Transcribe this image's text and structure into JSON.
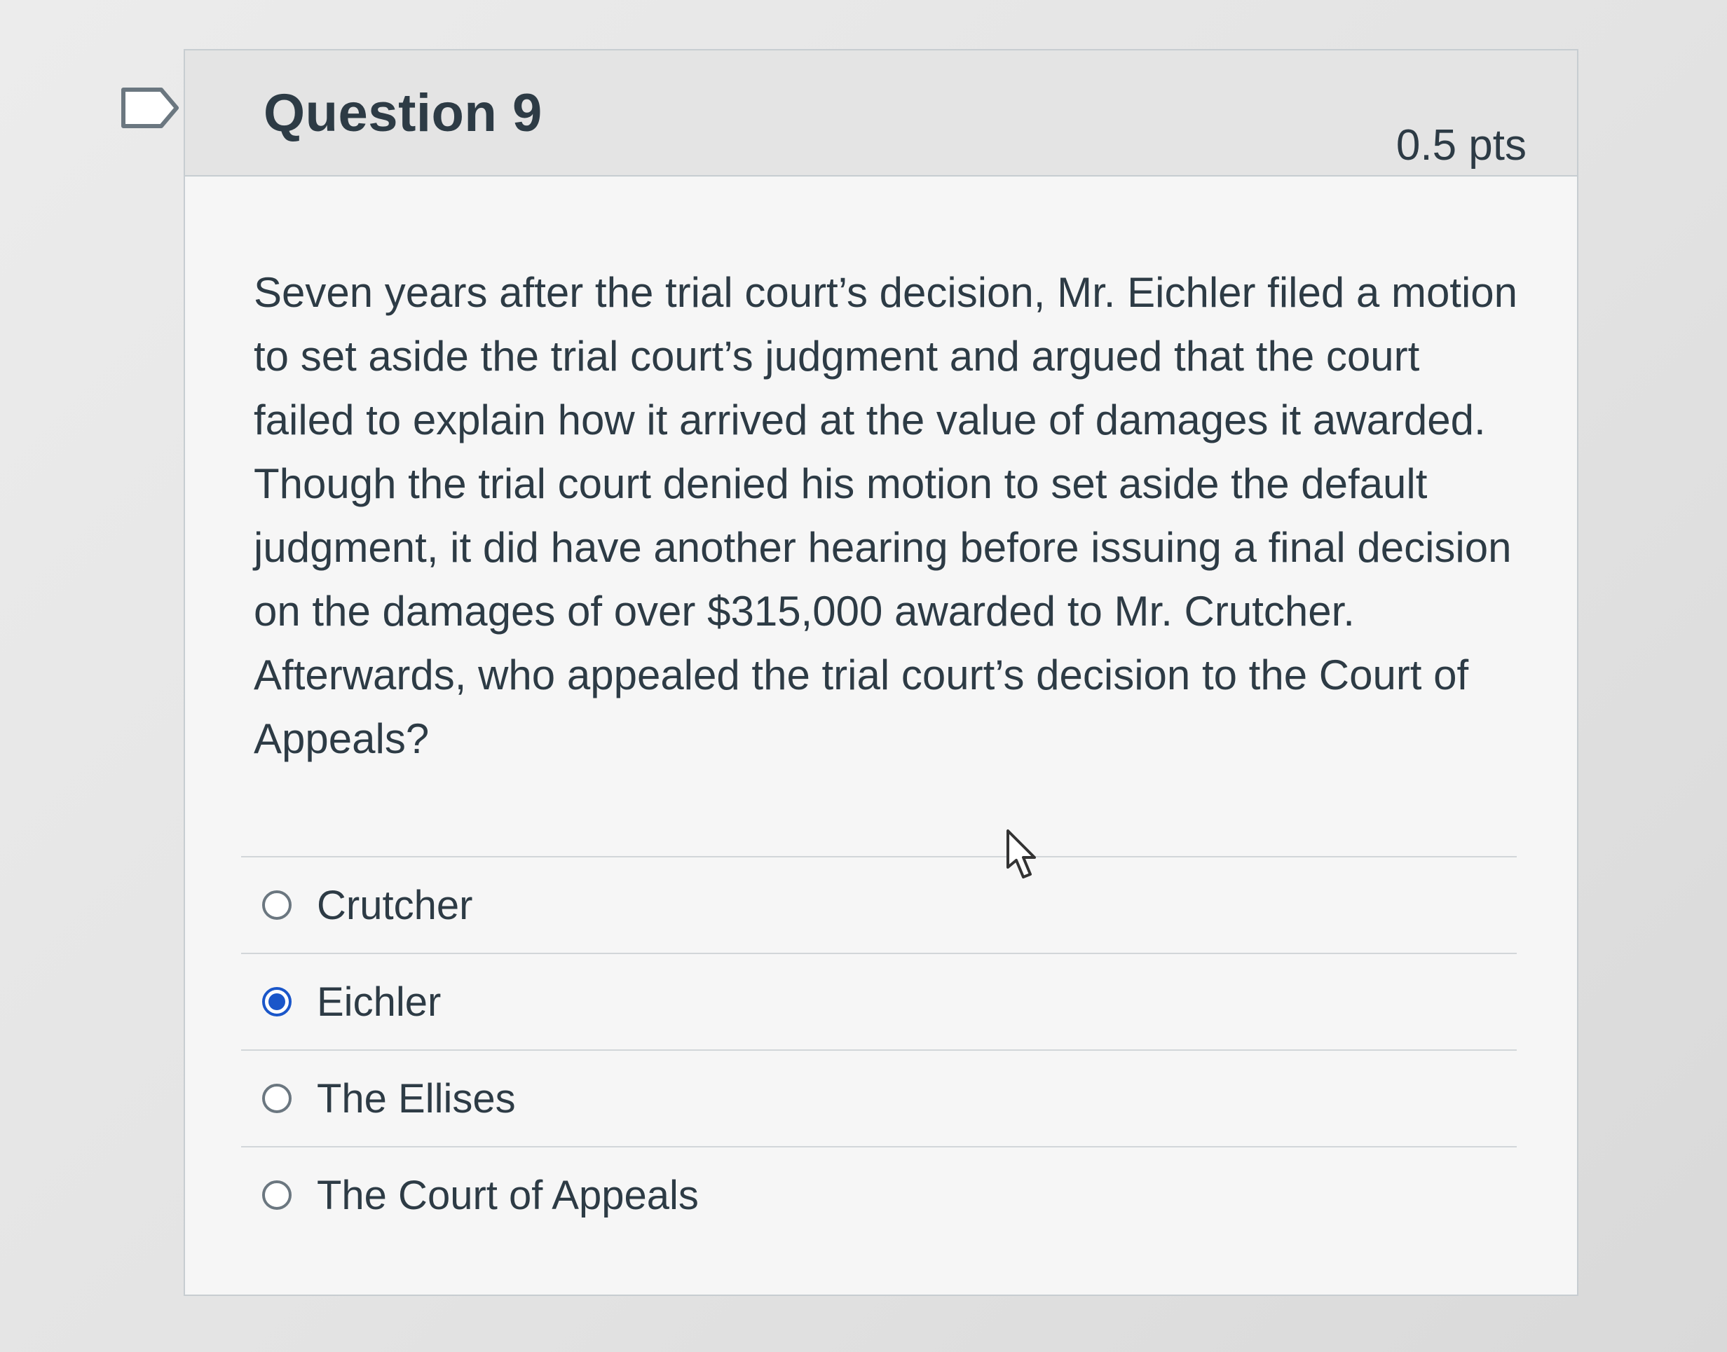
{
  "question": {
    "title": "Question 9",
    "points": "0.5 pts",
    "text": "Seven years after the trial court’s decision, Mr. Eichler filed a motion to set aside the trial court’s judgment and argued that the court failed to explain how it arrived at the value of damages it awarded. Though the trial court denied his motion to set aside the default judgment, it did have another hearing before issuing a final decision on the damages of over $315,000 awarded to Mr. Crutcher. Afterwards, who appealed the trial court’s decision to the Court of Appeals?",
    "answers": [
      {
        "label": "Crutcher",
        "selected": false
      },
      {
        "label": "Eichler",
        "selected": true
      },
      {
        "label": "The Ellises",
        "selected": false
      },
      {
        "label": "The Court of Appeals",
        "selected": false
      }
    ]
  },
  "icons": {
    "flag": "flag-question-icon",
    "cursor": "mouse-pointer-icon"
  },
  "colors": {
    "selected_radio": "#1a56c9",
    "header_bg": "#e4e4e4",
    "text": "#2d3b45"
  }
}
